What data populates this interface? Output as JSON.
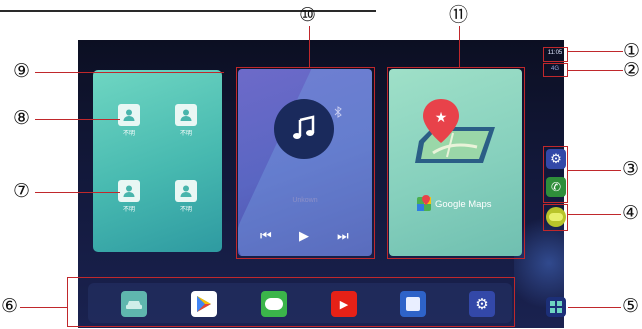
{
  "callouts": {
    "n1": "①",
    "n2": "②",
    "n3": "③",
    "n4": "④",
    "n5": "⑤",
    "n6": "⑥",
    "n7": "⑦",
    "n8": "⑧",
    "n9": "⑨",
    "n10": "⑩",
    "n11": "⑪"
  },
  "status": {
    "clock": "11:05",
    "network": "4G"
  },
  "contacts": {
    "items": [
      {
        "label": "不明"
      },
      {
        "label": "不明"
      },
      {
        "label": "不明"
      },
      {
        "label": "不明"
      }
    ]
  },
  "music": {
    "title": "Unkown"
  },
  "maps": {
    "label": "Google Maps"
  },
  "colors": {
    "accent_red": "#c0282c",
    "contacts_bg": "#47b9b0",
    "music_bg": "#5a66c2",
    "maps_bg": "#86d0bd"
  },
  "dock": {
    "icons": [
      "car-icon",
      "play-store-icon",
      "line-icon",
      "youtube-icon",
      "app-icon",
      "settings-icon"
    ]
  },
  "rail": {
    "icons": [
      "settings-icon",
      "phone-icon",
      "carplay-icon",
      "grid-icon"
    ]
  }
}
